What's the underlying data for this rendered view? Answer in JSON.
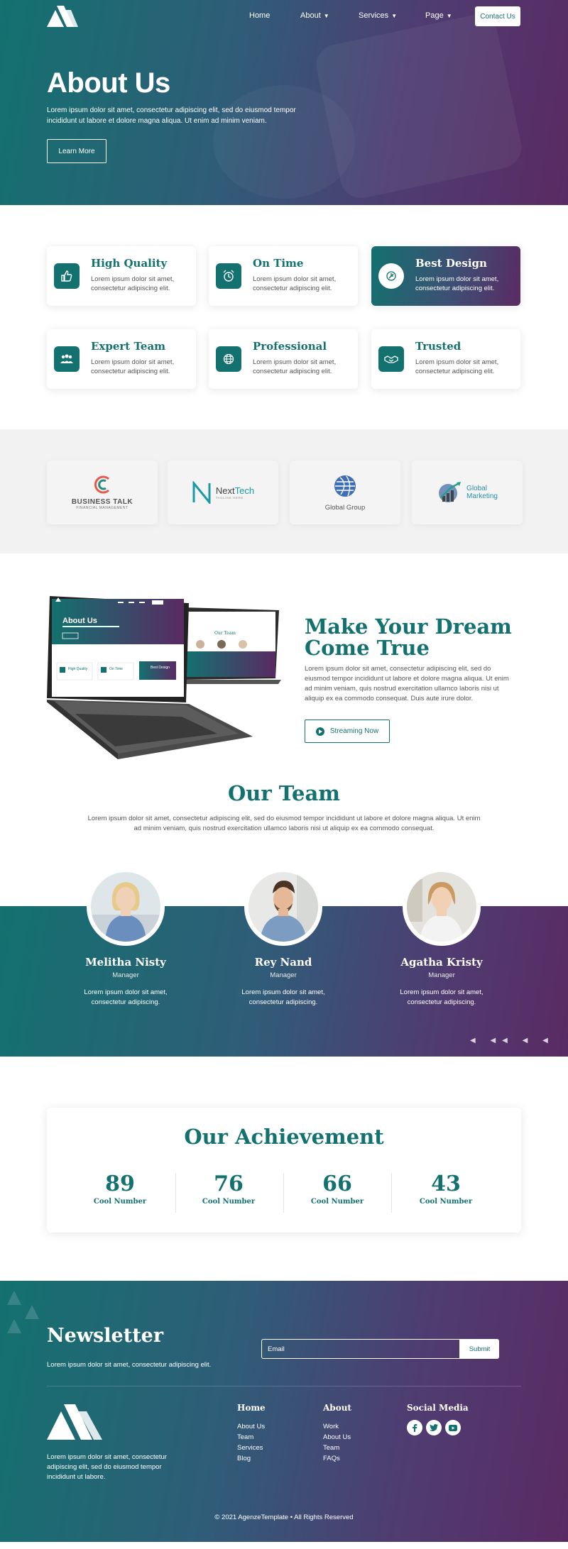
{
  "nav": {
    "home": "Home",
    "about": "About",
    "services": "Services",
    "page": "Page",
    "contact": "Contact Us"
  },
  "hero": {
    "title": "About Us",
    "text": "Lorem ipsum dolor sit amet, consectetur adipiscing elit, sed do eiusmod tempor incididunt ut labore et dolore magna aliqua. Ut enim ad minim veniam.",
    "button": "Learn More"
  },
  "features": [
    {
      "title": "High Quality",
      "text": "Lorem ipsum dolor sit amet, consectetur adipiscing elit.",
      "icon": "thumbs-up-icon"
    },
    {
      "title": "On Time",
      "text": "Lorem ipsum dolor sit amet, consectetur adipiscing elit.",
      "icon": "alarm-clock-icon"
    },
    {
      "title": "Best Design",
      "text": "Lorem ipsum dolor sit amet, consectetur adipiscing elit.",
      "icon": "design-icon"
    },
    {
      "title": "Expert Team",
      "text": "Lorem ipsum dolor sit amet, consectetur adipiscing elit.",
      "icon": "team-icon"
    },
    {
      "title": "Professional",
      "text": "Lorem ipsum dolor sit amet, consectetur adipiscing elit.",
      "icon": "globe-icon"
    },
    {
      "title": "Trusted",
      "text": "Lorem ipsum dolor sit amet, consectetur adipiscing elit.",
      "icon": "handshake-icon"
    }
  ],
  "partners": {
    "business_talk": {
      "name": "BUSINESS TALK",
      "tagline": "FINANCIAL MANAGEMENT"
    },
    "nexttech": {
      "name_a": "Next",
      "name_b": "Tech",
      "tagline": "TAGLINE HERE"
    },
    "global_group": {
      "name": "Global Group"
    },
    "global_marketing": {
      "line1": "Global",
      "line2": "Marketing"
    }
  },
  "mockup": {
    "title": "About Us",
    "screen_title": "Our Team",
    "card1": "High Quality",
    "card2": "On Time",
    "card3": "Best Design"
  },
  "dream": {
    "title": "Make Your Dream Come True",
    "text": "Lorem ipsum dolor sit amet, consectetur adipiscing elit, sed do eiusmod tempor incididunt ut labore et dolore magna aliqua. Ut enim ad minim veniam, quis nostrud exercitation ullamco laboris nisi ut aliquip ex ea commodo consequat. Duis aute irure dolor.",
    "button": "Streaming Now"
  },
  "team": {
    "title": "Our Team",
    "text": "Lorem ipsum dolor sit amet, consectetur adipiscing elit, sed do eiusmod tempor incididunt ut labore et dolore magna aliqua. Ut enim ad minim veniam, quis nostrud exercitation ullamco laboris nisi ut aliquip ex ea commodo consequat.",
    "members": [
      {
        "name": "Melitha Nisty",
        "role": "Manager",
        "text": "Lorem ipsum dolor sit amet, consectetur adipiscing."
      },
      {
        "name": "Rey Nand",
        "role": "Manager",
        "text": "Lorem ipsum dolor sit amet, consectetur adipiscing."
      },
      {
        "name": "Agatha Kristy",
        "role": "Manager",
        "text": "Lorem ipsum dolor sit amet, consectetur adipiscing."
      }
    ]
  },
  "achievement": {
    "title": "Our Achievement",
    "stats": [
      {
        "value": "89",
        "label": "Cool Number"
      },
      {
        "value": "76",
        "label": "Cool Number"
      },
      {
        "value": "66",
        "label": "Cool Number"
      },
      {
        "value": "43",
        "label": "Cool Number"
      }
    ]
  },
  "newsletter": {
    "title": "Newsletter",
    "text": "Lorem ipsum dolor sit amet, consectetur adipiscing elit.",
    "placeholder": "Email",
    "button": "Submit"
  },
  "footer": {
    "about": "Lorem ipsum dolor sit amet, consectetur adipiscing elit, sed do eiusmod tempor incididunt ut labore.",
    "home_col": {
      "title": "Home",
      "links": [
        "About Us",
        "Team",
        "Services",
        "Blog"
      ]
    },
    "about_col": {
      "title": "About",
      "links": [
        "Work",
        "About Us",
        "Team",
        "FAQs"
      ]
    },
    "social_col": {
      "title": "Social Media",
      "icons": [
        "facebook-icon",
        "twitter-icon",
        "youtube-icon"
      ]
    },
    "copyright": "© 2021 AgenzeTemplate • All Rights Reserved"
  },
  "colors": {
    "teal": "#13716f",
    "purple": "#5a2a63"
  }
}
